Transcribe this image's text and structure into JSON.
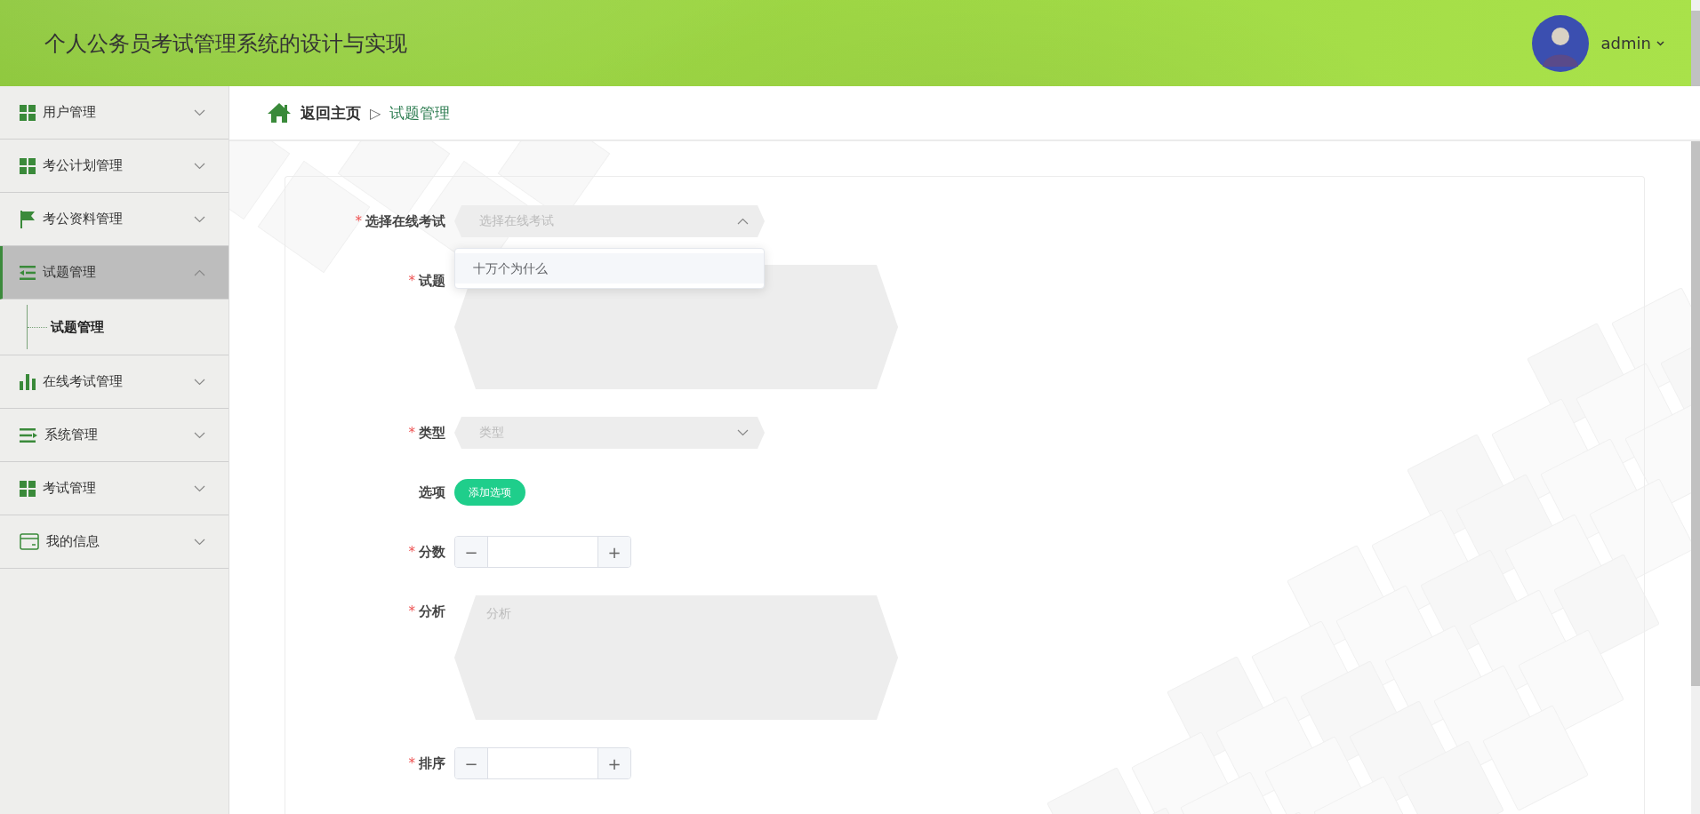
{
  "header": {
    "title": "个人公务员考试管理系统的设计与实现",
    "user": {
      "name": "admin"
    }
  },
  "sidebar": {
    "items": [
      {
        "label": "用户管理",
        "expanded": false,
        "selected": false
      },
      {
        "label": "考公计划管理",
        "expanded": false,
        "selected": false
      },
      {
        "label": "考公资料管理",
        "expanded": false,
        "selected": false
      },
      {
        "label": "试题管理",
        "expanded": true,
        "selected": true,
        "children": [
          {
            "label": "试题管理",
            "selected": true
          }
        ]
      },
      {
        "label": "在线考试管理",
        "expanded": false,
        "selected": false
      },
      {
        "label": "系统管理",
        "expanded": false,
        "selected": false
      },
      {
        "label": "考试管理",
        "expanded": false,
        "selected": false
      },
      {
        "label": "我的信息",
        "expanded": false,
        "selected": false
      }
    ]
  },
  "breadcrumb": {
    "home": "返回主页",
    "separator": "▷",
    "current": "试题管理"
  },
  "form": {
    "fields": [
      {
        "kind": "select",
        "label": "选择在线考试",
        "mark": "*",
        "placeholder": "选择在线考试",
        "open": true,
        "options": [
          {
            "label": "十万个为什么",
            "hovered": true
          }
        ]
      },
      {
        "kind": "textarea",
        "label": "试题",
        "mark": "*"
      },
      {
        "kind": "select",
        "label": "类型",
        "mark": "*",
        "placeholder": "类型",
        "open": false
      },
      {
        "kind": "button",
        "label": "选项",
        "button": "添加选项"
      },
      {
        "kind": "number",
        "label": "分数",
        "mark": "*",
        "minus": "−",
        "plus": "+"
      },
      {
        "kind": "textarea",
        "label": "分析",
        "mark": "*",
        "placeholder": "分析"
      },
      {
        "kind": "number",
        "label": "排序",
        "mark": "*",
        "minus": "−",
        "plus": "+"
      }
    ]
  }
}
